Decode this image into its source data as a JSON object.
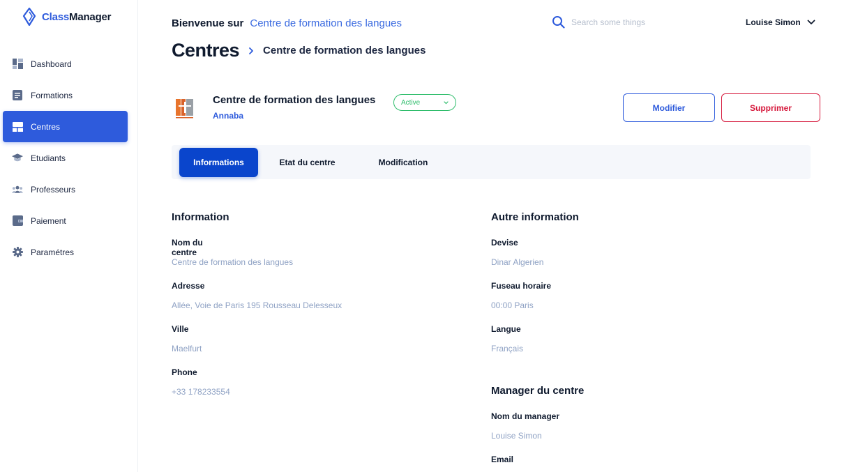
{
  "app": {
    "brand_part1": "Class",
    "brand_part2": "Manager"
  },
  "sidebar": {
    "items": [
      {
        "label": "Dashboard",
        "icon": "dashboard-icon",
        "active": false
      },
      {
        "label": "Formations",
        "icon": "formations-icon",
        "active": false
      },
      {
        "label": "Centres",
        "icon": "centres-icon",
        "active": true
      },
      {
        "label": "Etudiants",
        "icon": "graduation-cap-icon",
        "active": false
      },
      {
        "label": "Professeurs",
        "icon": "users-icon",
        "active": false
      },
      {
        "label": "Paiement",
        "icon": "wallet-icon",
        "active": false
      },
      {
        "label": "Paramétres",
        "icon": "gear-icon",
        "active": false
      }
    ]
  },
  "header": {
    "welcome_prefix": "Bienvenue sur",
    "welcome_center": "Centre de formation des langues",
    "search_placeholder": "Search some things",
    "user_name": "Louise Simon"
  },
  "breadcrumb": {
    "root": "Centres",
    "current": "Centre de formation des langues"
  },
  "center": {
    "name": "Centre de formation des langues",
    "city": "Annaba",
    "status": "Active",
    "edit_label": "Modifier",
    "delete_label": "Supprimer"
  },
  "tabs": [
    {
      "label": "Informations",
      "active": true
    },
    {
      "label": "Etat du centre",
      "active": false
    },
    {
      "label": "Modification",
      "active": false
    }
  ],
  "information": {
    "title": "Information",
    "fields": [
      {
        "label": "Nom du centre",
        "value": "Centre de formation des langues"
      },
      {
        "label": "Adresse",
        "value": "Allée, Voie de Paris 195 Rousseau Delesseux"
      },
      {
        "label": "Ville",
        "value": "Maelfurt"
      },
      {
        "label": "Phone",
        "value": "+33 178233554"
      }
    ]
  },
  "other_information": {
    "title": "Autre information",
    "fields": [
      {
        "label": "Devise",
        "value": "Dinar Algerien"
      },
      {
        "label": "Fuseau horaire",
        "value": "00:00 Paris"
      },
      {
        "label": "Langue",
        "value": "Français"
      }
    ]
  },
  "manager": {
    "title": "Manager du centre",
    "fields": [
      {
        "label": "Nom du manager",
        "value": "Louise Simon"
      },
      {
        "label": "Email",
        "value": ""
      }
    ]
  },
  "colors": {
    "primary": "#2e5bdc",
    "tab_active": "#0a45cc",
    "danger": "#d6193c",
    "success": "#2ebd6b",
    "muted_value": "#8fa2c4"
  }
}
